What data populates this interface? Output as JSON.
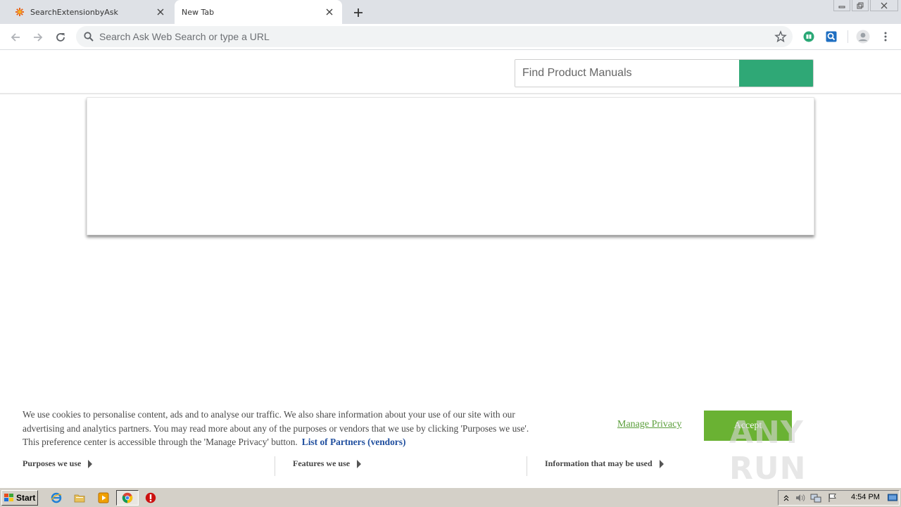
{
  "browser": {
    "tabs": [
      {
        "title": "SearchExtensionbyAsk",
        "active": false
      },
      {
        "title": "New Tab",
        "active": true
      }
    ],
    "omnibox": {
      "placeholder": "Search Ask Web Search or type a URL"
    }
  },
  "page": {
    "manuals_search": {
      "placeholder": "Find Product Manuals"
    },
    "accent_color": "#2fa876"
  },
  "cookie_banner": {
    "text": "We use cookies to personalise content, ads and to analyse our traffic. We also share information about your use of our site with our advertising and analytics partners. You may read more about any of the purposes or vendors that we use by clicking 'Purposes we use'. This preference center is accessible through the 'Manage Privacy' button.",
    "partners_link": "List of Partners (vendors)",
    "manage_privacy": "Manage Privacy",
    "accept": "Accept",
    "sections": [
      "Purposes we use",
      "Features we use",
      "Information that may be used"
    ]
  },
  "watermark": "ANY RUN",
  "taskbar": {
    "start_label": "Start",
    "clock": "4:54 PM"
  }
}
